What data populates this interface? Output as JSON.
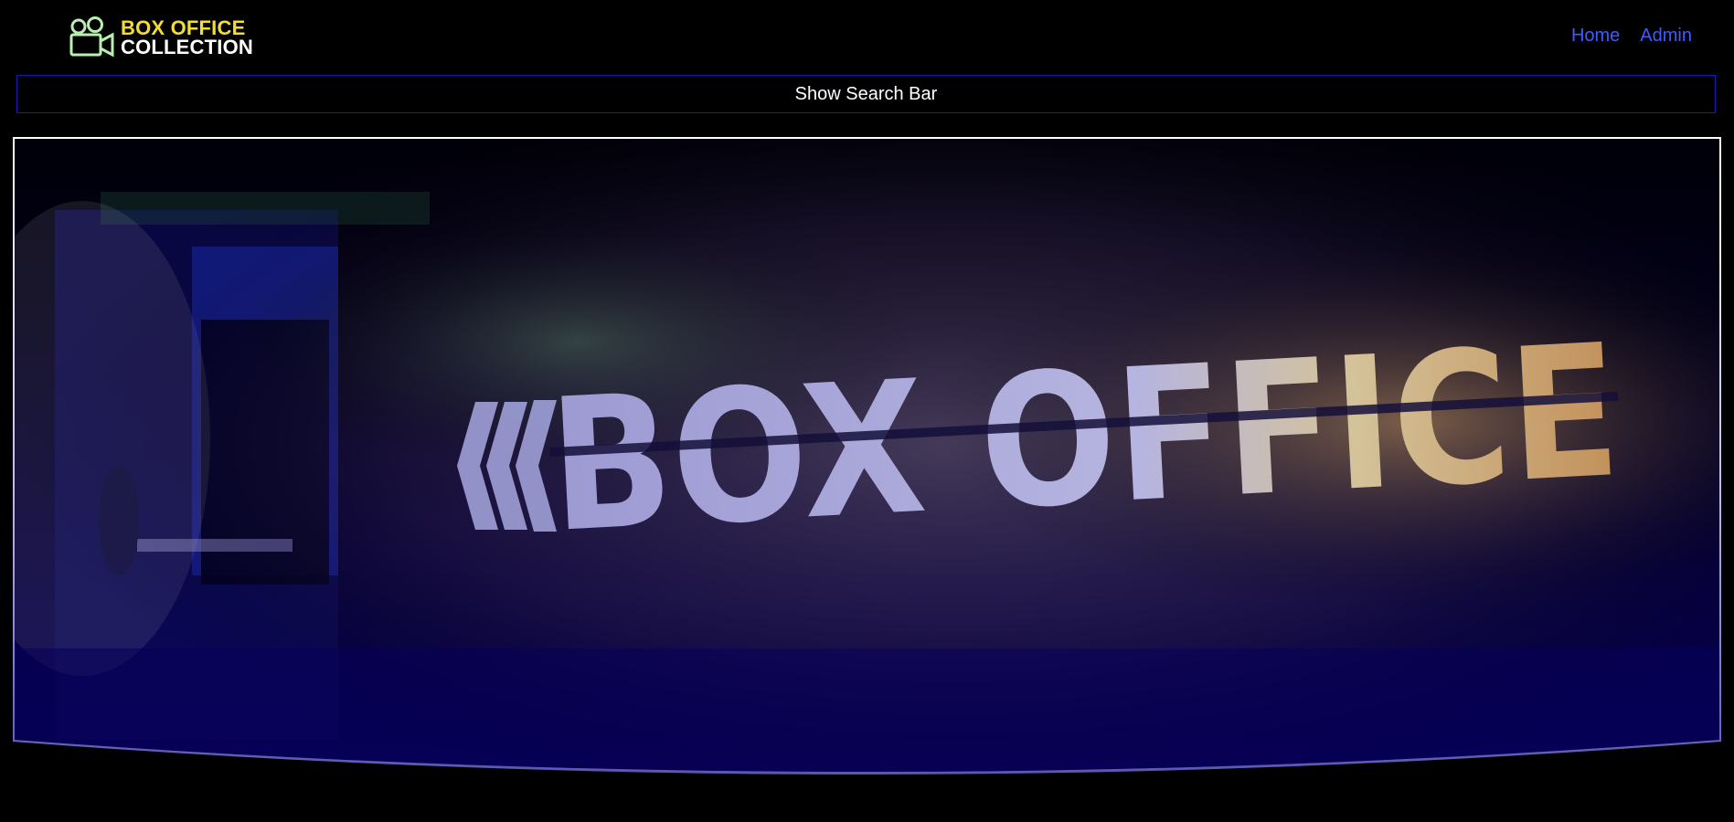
{
  "header": {
    "logo": {
      "line1": "BOX OFFICE",
      "line2": "COLLECTION",
      "icon": "movie-camera-icon",
      "colors": {
        "line1": "#f5dd2e",
        "line2": "#ffffff",
        "icon": "#b8f0b0"
      }
    },
    "nav": [
      {
        "label": "Home"
      },
      {
        "label": "Admin"
      }
    ],
    "nav_color": "#3d5cff"
  },
  "search_toggle": {
    "label": "Show Search Bar",
    "border_color": "#1a1ab8"
  },
  "hero": {
    "wall_text": "BOX OFFICE",
    "colors": {
      "tint": "#07005a",
      "frame": "#ffffff",
      "letters": "#b4b2dc"
    }
  }
}
